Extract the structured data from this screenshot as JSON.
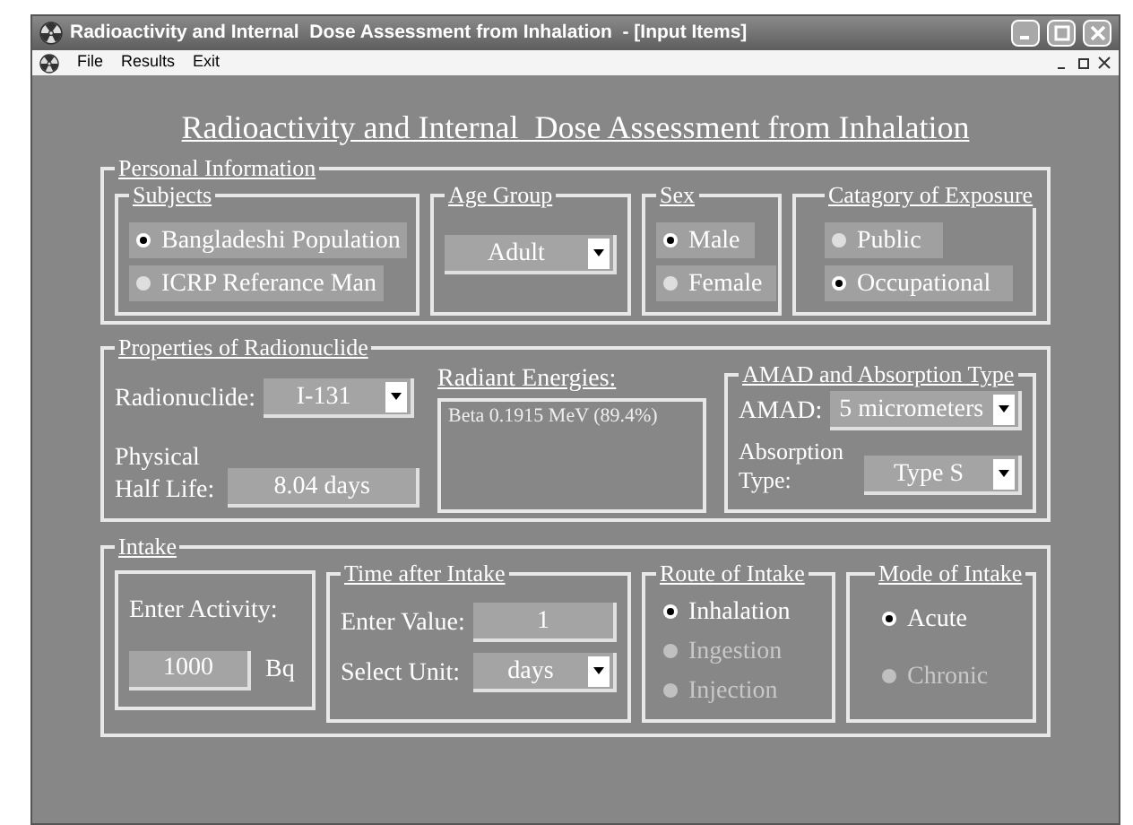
{
  "window": {
    "title": "Radioactivity and Internal  Dose Assessment from Inhalation  - [Input Items]"
  },
  "menu": [
    "File",
    "Results",
    "Exit"
  ],
  "heading": "Radioactivity and Internal  Dose Assessment from Inhalation",
  "personal_information": {
    "legend": "Personal Information",
    "subjects": {
      "legend": "Subjects",
      "options": [
        {
          "label": "Bangladeshi Population",
          "selected": true
        },
        {
          "label": "ICRP Referance Man",
          "selected": false
        }
      ]
    },
    "age_group": {
      "legend": "Age Group",
      "value": "Adult"
    },
    "sex": {
      "legend": "Sex",
      "options": [
        {
          "label": "Male",
          "selected": true
        },
        {
          "label": "Female",
          "selected": false
        }
      ]
    },
    "exposure": {
      "legend": "Catagory of Exposure",
      "options": [
        {
          "label": "Public",
          "selected": false
        },
        {
          "label": "Occupational",
          "selected": true
        }
      ]
    }
  },
  "properties": {
    "legend": "Properties of Radionuclide",
    "radionuclide_label": "Radionuclide:",
    "radionuclide": "I-131",
    "half_life_label": "Physical Half Life:",
    "half_life": "8.04 days",
    "energies_label": "Radiant Energies:",
    "energies": "Beta 0.1915 MeV (89.4%)",
    "amad_group": {
      "legend": "AMAD and Absorption Type",
      "amad_label": "AMAD:",
      "amad": "5 micrometers",
      "absorption_label": "Absorption Type:",
      "absorption": "Type S"
    }
  },
  "intake": {
    "legend": "Intake",
    "activity_label": "Enter Activity:",
    "activity": "1000",
    "activity_unit": "Bq",
    "time": {
      "legend": "Time after Intake",
      "value_label": "Enter Value:",
      "value": "1",
      "unit_label": "Select Unit:",
      "unit": "days"
    },
    "route": {
      "legend": "Route of Intake",
      "options": [
        {
          "label": "Inhalation",
          "selected": true,
          "disabled": false
        },
        {
          "label": "Ingestion",
          "selected": false,
          "disabled": true
        },
        {
          "label": "Injection",
          "selected": false,
          "disabled": true
        }
      ]
    },
    "mode": {
      "legend": "Mode of Intake",
      "options": [
        {
          "label": "Acute",
          "selected": true,
          "disabled": false
        },
        {
          "label": "Chronic",
          "selected": false,
          "disabled": true
        }
      ]
    }
  }
}
